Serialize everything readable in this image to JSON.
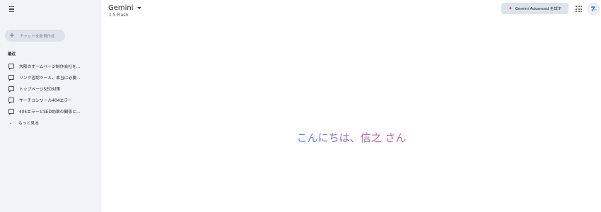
{
  "sidebar": {
    "new_chat_label": "チャットを新規作成",
    "recent_heading": "最近",
    "recent_items": [
      {
        "label": "大阪のホームページ制作会社を..."
      },
      {
        "label": "リンク否認ツール、本当に必要..."
      },
      {
        "label": "トップページSEO対策"
      },
      {
        "label": "サーチコンソール404エラー"
      },
      {
        "label": "404エラーとSEO効果の関係と..."
      }
    ],
    "show_more_label": "もっと見る"
  },
  "header": {
    "model_name": "Gemini",
    "model_version": "1.5 Flash",
    "advanced_button_label": "Gemini Advanced を試す"
  },
  "main": {
    "greeting": "こんにちは、信之 さん"
  },
  "colors": {
    "sidebar_bg": "#f0f4f9",
    "button_bg": "#dde3ea",
    "greeting_gradient_start": "#4285f4",
    "greeting_gradient_end": "#d96570",
    "sparkle": "#d93025"
  },
  "icons": {
    "menu": "menu-icon",
    "new_chat": "plus-icon",
    "chat": "chat-bubble-icon",
    "show_more": "chevron-down-icon",
    "model_dropdown": "caret-down-icon",
    "advanced": "sparkle-icon",
    "apps": "apps-grid-icon",
    "account": "account-avatar"
  }
}
